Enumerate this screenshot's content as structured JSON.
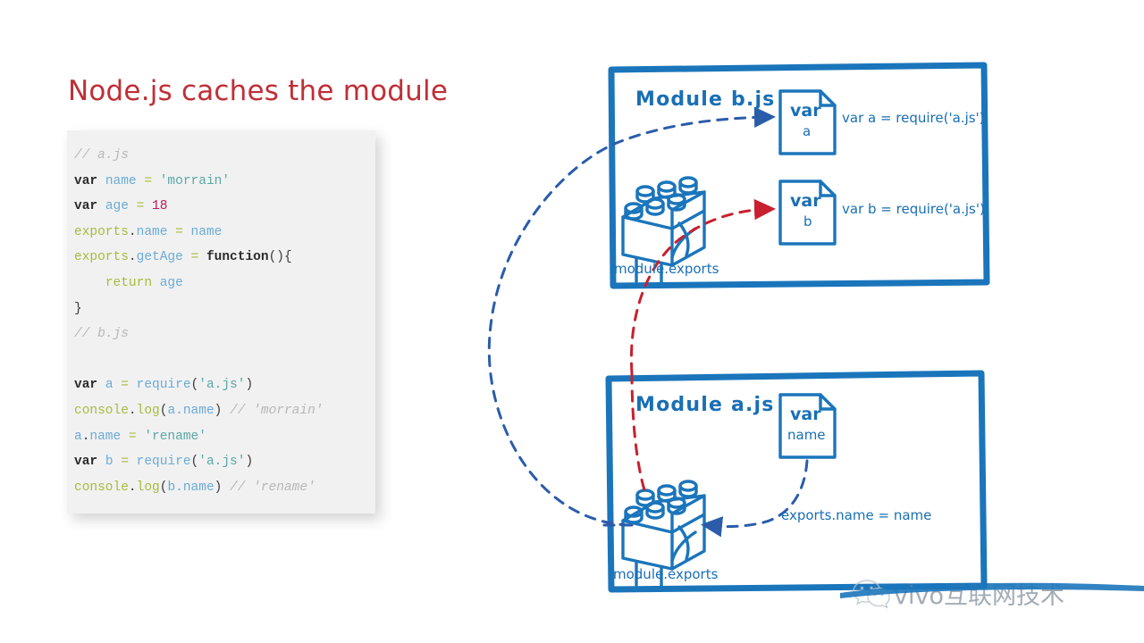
{
  "title": "Node.js caches the module",
  "colors": {
    "title": "#bf2f36",
    "box_blue": "#1b75bb",
    "diagram_blue": "#1a6fb5",
    "dashed_blue": "#2a5caa",
    "dashed_red": "#c8202e",
    "code_bg": "#f1f1f1"
  },
  "code": {
    "lines": [
      [
        {
          "t": "// a.js",
          "c": "comment"
        }
      ],
      [
        {
          "t": "var",
          "c": "kw"
        },
        {
          "t": " ",
          "c": "plain"
        },
        {
          "t": "name",
          "c": "var"
        },
        {
          "t": " ",
          "c": "plain"
        },
        {
          "t": "=",
          "c": "op"
        },
        {
          "t": " ",
          "c": "plain"
        },
        {
          "t": "'morrain'",
          "c": "str"
        }
      ],
      [
        {
          "t": "var",
          "c": "kw"
        },
        {
          "t": " ",
          "c": "plain"
        },
        {
          "t": "age",
          "c": "var"
        },
        {
          "t": " ",
          "c": "plain"
        },
        {
          "t": "=",
          "c": "op"
        },
        {
          "t": " ",
          "c": "plain"
        },
        {
          "t": "18",
          "c": "num"
        }
      ],
      [
        {
          "t": "exports",
          "c": "prop"
        },
        {
          "t": ".",
          "c": "plain"
        },
        {
          "t": "name",
          "c": "var"
        },
        {
          "t": " ",
          "c": "plain"
        },
        {
          "t": "=",
          "c": "op"
        },
        {
          "t": " ",
          "c": "plain"
        },
        {
          "t": "name",
          "c": "var"
        }
      ],
      [
        {
          "t": "exports",
          "c": "prop"
        },
        {
          "t": ".",
          "c": "plain"
        },
        {
          "t": "getAge",
          "c": "var"
        },
        {
          "t": " ",
          "c": "plain"
        },
        {
          "t": "=",
          "c": "op"
        },
        {
          "t": " ",
          "c": "plain"
        },
        {
          "t": "function",
          "c": "kw"
        },
        {
          "t": "(){",
          "c": "plain"
        }
      ],
      [
        {
          "t": "    ",
          "c": "plain"
        },
        {
          "t": "return",
          "c": "prop"
        },
        {
          "t": " ",
          "c": "plain"
        },
        {
          "t": "age",
          "c": "var"
        }
      ],
      [
        {
          "t": "}",
          "c": "plain"
        }
      ],
      [
        {
          "t": "// b.js",
          "c": "comment"
        }
      ],
      [
        {
          "t": " ",
          "c": "plain"
        }
      ],
      [
        {
          "t": "var",
          "c": "kw"
        },
        {
          "t": " ",
          "c": "plain"
        },
        {
          "t": "a",
          "c": "var"
        },
        {
          "t": " ",
          "c": "plain"
        },
        {
          "t": "=",
          "c": "op"
        },
        {
          "t": " ",
          "c": "plain"
        },
        {
          "t": "require",
          "c": "fn"
        },
        {
          "t": "(",
          "c": "plain"
        },
        {
          "t": "'a.js'",
          "c": "str"
        },
        {
          "t": ")",
          "c": "plain"
        }
      ],
      [
        {
          "t": "console",
          "c": "prop"
        },
        {
          "t": ".",
          "c": "plain"
        },
        {
          "t": "log",
          "c": "prop"
        },
        {
          "t": "(",
          "c": "plain"
        },
        {
          "t": "a.name",
          "c": "var"
        },
        {
          "t": ")",
          "c": "plain"
        },
        {
          "t": " ",
          "c": "plain"
        },
        {
          "t": "// 'morrain'",
          "c": "comment"
        }
      ],
      [
        {
          "t": "a",
          "c": "var"
        },
        {
          "t": ".",
          "c": "plain"
        },
        {
          "t": "name",
          "c": "var"
        },
        {
          "t": " ",
          "c": "plain"
        },
        {
          "t": "=",
          "c": "op"
        },
        {
          "t": " ",
          "c": "plain"
        },
        {
          "t": "'rename'",
          "c": "str"
        }
      ],
      [
        {
          "t": "var",
          "c": "kw"
        },
        {
          "t": " ",
          "c": "plain"
        },
        {
          "t": "b",
          "c": "var"
        },
        {
          "t": " ",
          "c": "plain"
        },
        {
          "t": "=",
          "c": "op"
        },
        {
          "t": " ",
          "c": "plain"
        },
        {
          "t": "require",
          "c": "fn"
        },
        {
          "t": "(",
          "c": "plain"
        },
        {
          "t": "'a.js'",
          "c": "str"
        },
        {
          "t": ")",
          "c": "plain"
        }
      ],
      [
        {
          "t": "console",
          "c": "prop"
        },
        {
          "t": ".",
          "c": "plain"
        },
        {
          "t": "log",
          "c": "prop"
        },
        {
          "t": "(",
          "c": "plain"
        },
        {
          "t": "b.name",
          "c": "var"
        },
        {
          "t": ")",
          "c": "plain"
        },
        {
          "t": " ",
          "c": "plain"
        },
        {
          "t": "// 'rename'",
          "c": "comment"
        }
      ]
    ]
  },
  "diagram": {
    "module_b": {
      "title": "Module b.js",
      "exports_label": "module.exports",
      "doc_a": {
        "top": "var",
        "bottom": "a"
      },
      "doc_b": {
        "top": "var",
        "bottom": "b"
      },
      "expr_a": "var a = require('a.js')",
      "expr_b": "var b = require('a.js')"
    },
    "module_a": {
      "title": "Module a.js",
      "exports_label": "module.exports",
      "doc_name": {
        "top": "var",
        "bottom": "name"
      },
      "expr_exports": "exports.name = name"
    }
  },
  "watermark": {
    "text": "vivo互联网技术",
    "icon": "wechat-icon"
  }
}
